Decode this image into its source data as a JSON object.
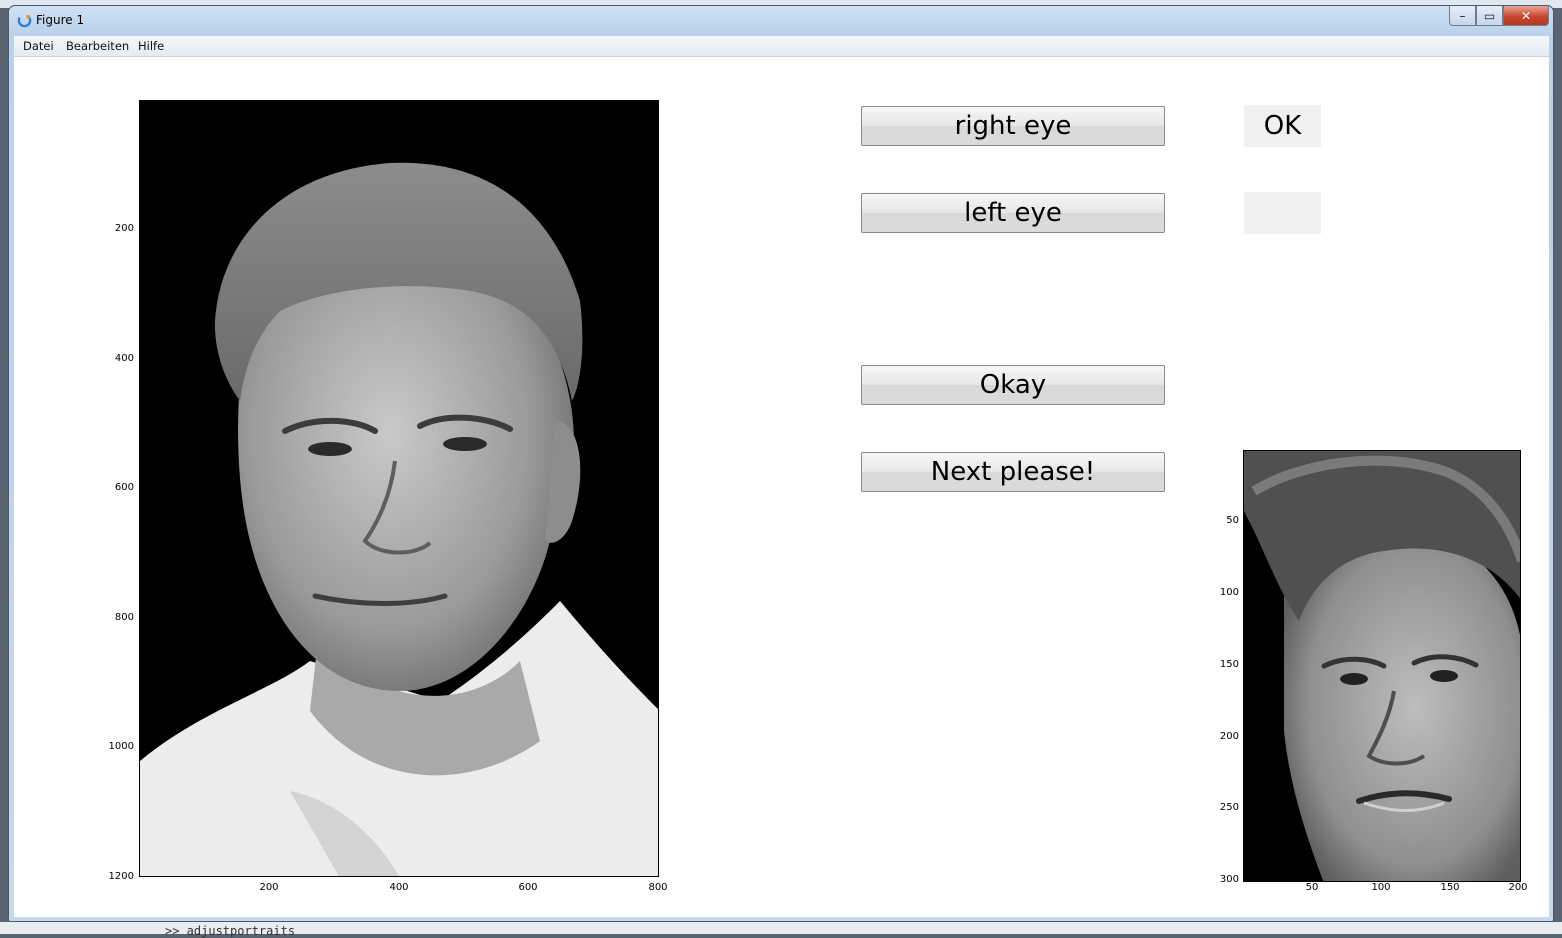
{
  "window": {
    "title": "Figure 1",
    "minimize_glyph": "–",
    "maximize_glyph": "▭",
    "close_glyph": "✕"
  },
  "menu": {
    "items": [
      "Datei",
      "Bearbeiten",
      "Hilfe"
    ]
  },
  "background_command": ">> adjustportraits",
  "main_image_axes": {
    "y_ticks": [
      "200",
      "400",
      "600",
      "800",
      "1000",
      "1200"
    ],
    "x_ticks": [
      "200",
      "400",
      "600",
      "800"
    ]
  },
  "thumbnail_axes": {
    "y_ticks": [
      "50",
      "100",
      "150",
      "200",
      "250",
      "300"
    ],
    "x_ticks": [
      "50",
      "100",
      "150",
      "200"
    ]
  },
  "buttons": {
    "right_eye": "right eye",
    "left_eye": "left eye",
    "okay": "Okay",
    "next": "Next please!"
  },
  "status": {
    "right_eye_status": "OK",
    "left_eye_status": ""
  },
  "colors": {
    "image_background": "#000000",
    "button_face": "#e6e6e6",
    "status_box": "#f0f0f0"
  }
}
